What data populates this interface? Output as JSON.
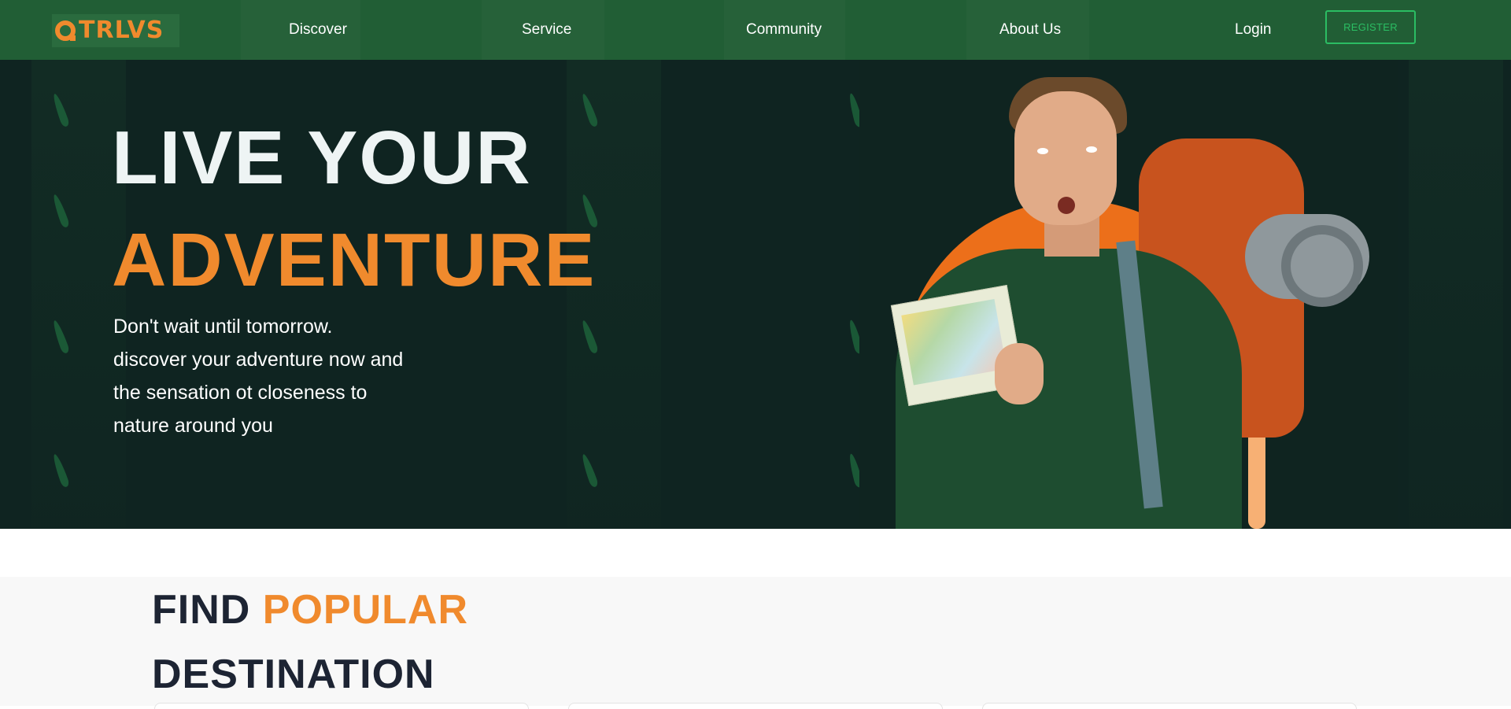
{
  "nav": {
    "logo_text": "TRLVS",
    "links": [
      "Discover",
      "Service",
      "Community",
      "About Us"
    ],
    "login_label": "Login",
    "register_label": "REGISTER"
  },
  "hero": {
    "title_line1": "LIVE YOUR",
    "title_line2": "ADVENTURE",
    "subtitle_lines": [
      "Don't wait until tomorrow.",
      "discover your adventure now and",
      "the sensation ot closeness to",
      "nature around you"
    ]
  },
  "popular": {
    "title_word1": "FIND",
    "title_accent": "POPULAR",
    "title_line2": "DESTINATION"
  },
  "colors": {
    "nav_bg": "#215e35",
    "hero_bg": "#0f2421",
    "accent_orange": "#f08a2d",
    "register_green": "#2bbd63",
    "heading_dark": "#1d2433"
  }
}
